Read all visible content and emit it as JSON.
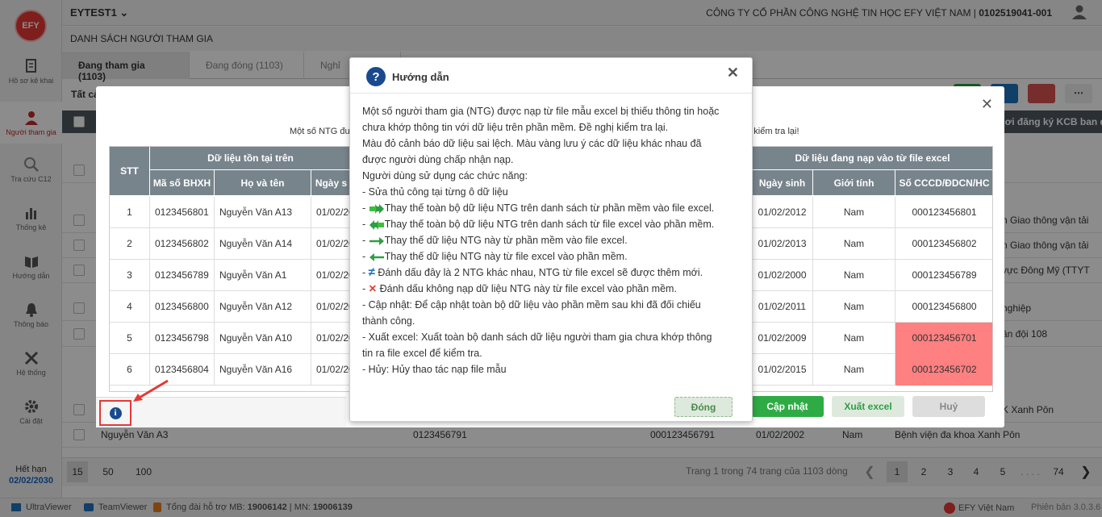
{
  "sidebar": {
    "logo": "EFY",
    "items": [
      {
        "label": "Hồ sơ kê khai",
        "icon": "document-edit-icon"
      },
      {
        "label": "Người tham gia",
        "icon": "person-icon"
      },
      {
        "label": "Tra cứu C12",
        "icon": "search-icon"
      },
      {
        "label": "Thống kê",
        "icon": "bar-chart-icon"
      },
      {
        "label": "Hướng dẫn",
        "icon": "book-icon"
      },
      {
        "label": "Thông báo",
        "icon": "bell-icon"
      },
      {
        "label": "Hệ thống",
        "icon": "tools-icon"
      },
      {
        "label": "Cài đặt",
        "icon": "gear-icon"
      }
    ],
    "expiry_label": "Hết hạn",
    "expiry_date": "02/02/2030"
  },
  "header": {
    "account": "EYTEST1",
    "company": "CÔNG TY CỔ PHẦN CÔNG NGHỆ TIN HỌC EFY VIỆT NAM | ",
    "tax_code": "0102519041-001",
    "page_title": "DANH SÁCH NGƯỜI THAM GIA"
  },
  "tabs": [
    "Đang tham gia (1103)",
    "Đang đóng (1103)",
    "Nghỉ"
  ],
  "toolbar_label": "Tất cả",
  "background_table": {
    "header_right": "Nơi đăng ký KCB ban đầu",
    "right_fragments": [
      "n Giao thông vận tải",
      "n Giao thông vận tải",
      "vực Đông Mỹ (TTYT",
      "nghiệp",
      "ân đội 108",
      "",
      "K Xanh Pôn"
    ],
    "last_row": {
      "name": "Nguyễn Văn A3",
      "bhxh": "0123456791",
      "cccd": "000123456791",
      "dob": "01/02/2002",
      "gender": "Nam",
      "hospital": "Bệnh viện đa khoa Xanh Pôn"
    }
  },
  "compare_modal": {
    "message_left": "Một số NTG đư",
    "message_right": "ng kiểm tra lại!",
    "group_left": "Dữ liệu tồn tại trên",
    "group_right": "Dữ liệu đang nạp vào từ file excel",
    "columns": {
      "stt": "STT",
      "bhxh": "Mã số BHXH",
      "name": "Họ và tên",
      "dob_left": "Ngày s",
      "dob": "Ngày sinh",
      "gender": "Giới tính",
      "id": "Số CCCD/ĐDCN/HC"
    },
    "rows": [
      {
        "stt": "1",
        "bhxh": "0123456801",
        "name": "Nguyễn Văn A13",
        "dob_l": "01/02/20",
        "dob": "01/02/2012",
        "gender": "Nam",
        "id": "000123456801",
        "id_mismatch": false
      },
      {
        "stt": "2",
        "bhxh": "0123456802",
        "name": "Nguyễn Văn A14",
        "dob_l": "01/02/20",
        "dob": "01/02/2013",
        "gender": "Nam",
        "id": "000123456802",
        "id_mismatch": false
      },
      {
        "stt": "3",
        "bhxh": "0123456789",
        "name": "Nguyễn Văn A1",
        "dob_l": "01/02/20",
        "dob": "01/02/2000",
        "gender": "Nam",
        "id": "000123456789",
        "id_mismatch": false
      },
      {
        "stt": "4",
        "bhxh": "0123456800",
        "name": "Nguyễn Văn A12",
        "dob_l": "01/02/20",
        "dob": "01/02/2011",
        "gender": "Nam",
        "id": "000123456800",
        "id_mismatch": false
      },
      {
        "stt": "5",
        "bhxh": "0123456798",
        "name": "Nguyễn Văn A10",
        "dob_l": "01/02/20",
        "dob": "01/02/2009",
        "gender": "Nam",
        "id": "000123456701",
        "id_mismatch": true
      },
      {
        "stt": "6",
        "bhxh": "0123456804",
        "name": "Nguyễn Văn A16",
        "dob_l": "01/02/20",
        "dob": "01/02/2015",
        "gender": "Nam",
        "id": "000123456702",
        "id_mismatch": true
      }
    ],
    "update_label": "Cập nhật",
    "export_label": "Xuất excel",
    "cancel_label": "Huỷ",
    "mismatch_color": "#ff8080"
  },
  "guide": {
    "title": "Hướng dẫn",
    "lines": [
      "Một số người tham gia (NTG) được nạp từ file mẫu excel bị thiếu thông tin hoặc",
      "chưa khớp thông tin với dữ liệu trên phần mềm. Đề nghị kiểm tra lại.",
      "Màu đỏ cảnh báo dữ liệu sai lệch. Màu vàng lưu ý các dữ liệu khác nhau đã",
      "được người dùng chấp nhận nạp.",
      "Người dùng sử dụng các chức năng:",
      "- Sửa thủ công tại từng ô dữ liệu"
    ],
    "icon_lines": [
      {
        "icon": "double-arrow-right-icon",
        "text": "Thay thế toàn bộ dữ liệu NTG trên danh sách từ phần mềm vào file excel."
      },
      {
        "icon": "double-arrow-left-icon",
        "text": "Thay thế toàn bộ dữ liệu NTG trên danh sách từ file excel vào phần mềm."
      },
      {
        "icon": "arrow-right-icon",
        "text": "Thay thế dữ liệu NTG này từ phần mềm vào file excel."
      },
      {
        "icon": "arrow-left-icon",
        "text": "Thay thế dữ liệu NTG này từ file excel vào phần mềm."
      },
      {
        "icon": "not-equal-icon",
        "text": " Đánh dấu đây là 2 NTG khác nhau, NTG từ file excel sẽ được thêm mới."
      },
      {
        "icon": "red-x-icon",
        "text": " Đánh dấu không nạp dữ liệu NTG này từ file excel vào phần mềm."
      }
    ],
    "tail_lines": [
      "- Cập nhật: Để cập nhật toàn bộ dữ liệu vào phần mềm sau khi đã đối chiếu",
      "thành công.",
      "- Xuất excel: Xuất toàn bộ danh sách dữ liệu người tham gia chưa khớp thông",
      "tin ra file excel để kiểm tra.",
      "- Hủy: Hủy thao tác nạp file mẫu"
    ],
    "close_label": "Đóng"
  },
  "pager": {
    "sizes": [
      "15",
      "50",
      "100"
    ],
    "info": "Trang 1 trong 74 trang của 1103 dòng",
    "pages": [
      "1",
      "2",
      "3",
      "4",
      "5",
      ". . . .",
      "74"
    ]
  },
  "status": {
    "ultraviewer": "UltraViewer",
    "teamviewer": "TeamViewer",
    "hotline_label": "Tổng đài hỗ trợ MB: ",
    "mb": "19006142",
    "mn_label": " | MN: ",
    "mn": "19006139",
    "brand": "EFY Việt Nam",
    "version": "Phiên bản 3.0.3.6"
  }
}
